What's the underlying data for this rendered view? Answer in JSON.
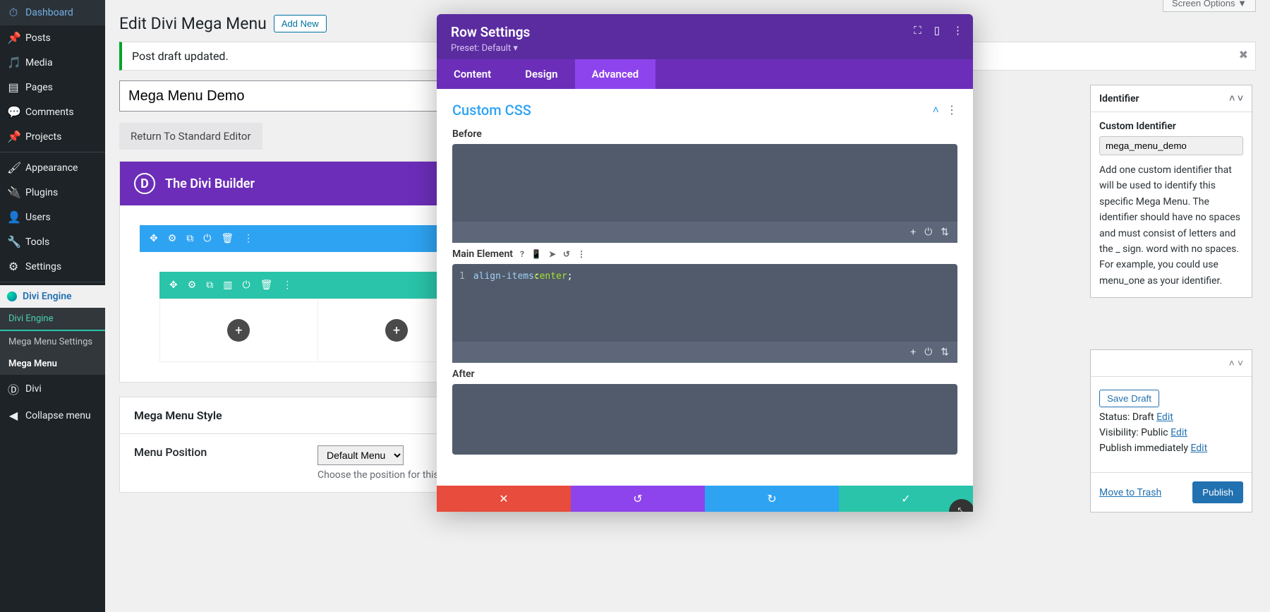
{
  "sidebar": {
    "items": [
      {
        "icon": "🏠",
        "label": "Dashboard"
      },
      {
        "icon": "📌",
        "label": "Posts"
      },
      {
        "icon": "🖼",
        "label": "Media"
      },
      {
        "icon": "📄",
        "label": "Pages"
      },
      {
        "icon": "💬",
        "label": "Comments"
      },
      {
        "icon": "📌",
        "label": "Projects"
      },
      {
        "icon": "🖌",
        "label": "Appearance"
      },
      {
        "icon": "🔌",
        "label": "Plugins"
      },
      {
        "icon": "👤",
        "label": "Users"
      },
      {
        "icon": "🔧",
        "label": "Tools"
      },
      {
        "icon": "⚙",
        "label": "Settings"
      }
    ],
    "divi_engine": "Divi Engine",
    "sub": [
      {
        "label": "Divi Engine"
      },
      {
        "label": "Mega Menu Settings"
      },
      {
        "label": "Mega Menu",
        "active": true
      }
    ],
    "divi": "Divi",
    "collapse": "Collapse menu"
  },
  "header": {
    "title": "Edit Divi Mega Menu",
    "add_new": "Add New",
    "screen_options": "Screen Options ▼"
  },
  "notice": {
    "text": "Post draft updated."
  },
  "title_input": "Mega Menu Demo",
  "return_btn": "Return To Standard Editor",
  "divi_builder": {
    "title": "The Divi Builder"
  },
  "style_box": {
    "title": "Mega Menu Style",
    "menu_position_label": "Menu Position",
    "menu_position_value": "Default Menu",
    "menu_position_hint": "Choose the position for this Mega."
  },
  "metabox": {
    "title": "Identifier",
    "field_label": "Custom Identifier",
    "field_value": "mega_menu_demo",
    "desc": "Add one custom identifier that will be used to identify this specific Mega Menu. The identifier should have no spaces and must consist of letters and the _ sign. word with no spaces. For example, you could use menu_one as your identifier."
  },
  "publish": {
    "save_draft": "Save Draft",
    "status": "Status: Draft",
    "edit": "Edit",
    "visibility": "Visibility: Public",
    "schedule": "Publish immediately",
    "trash": "Move to Trash",
    "publish": "Publish"
  },
  "modal": {
    "title": "Row Settings",
    "preset": "Preset: Default ▾",
    "tabs": {
      "content": "Content",
      "design": "Design",
      "advanced": "Advanced"
    },
    "section_title": "Custom CSS",
    "fields": {
      "before": "Before",
      "main": "Main Element",
      "after": "After"
    },
    "code": {
      "line_no": "1",
      "prop": "align-items",
      "val": "center"
    },
    "footer_icons": {
      "cancel": "✕",
      "undo": "↺",
      "redo": "↻",
      "save": "✓"
    }
  },
  "chart_data": null
}
